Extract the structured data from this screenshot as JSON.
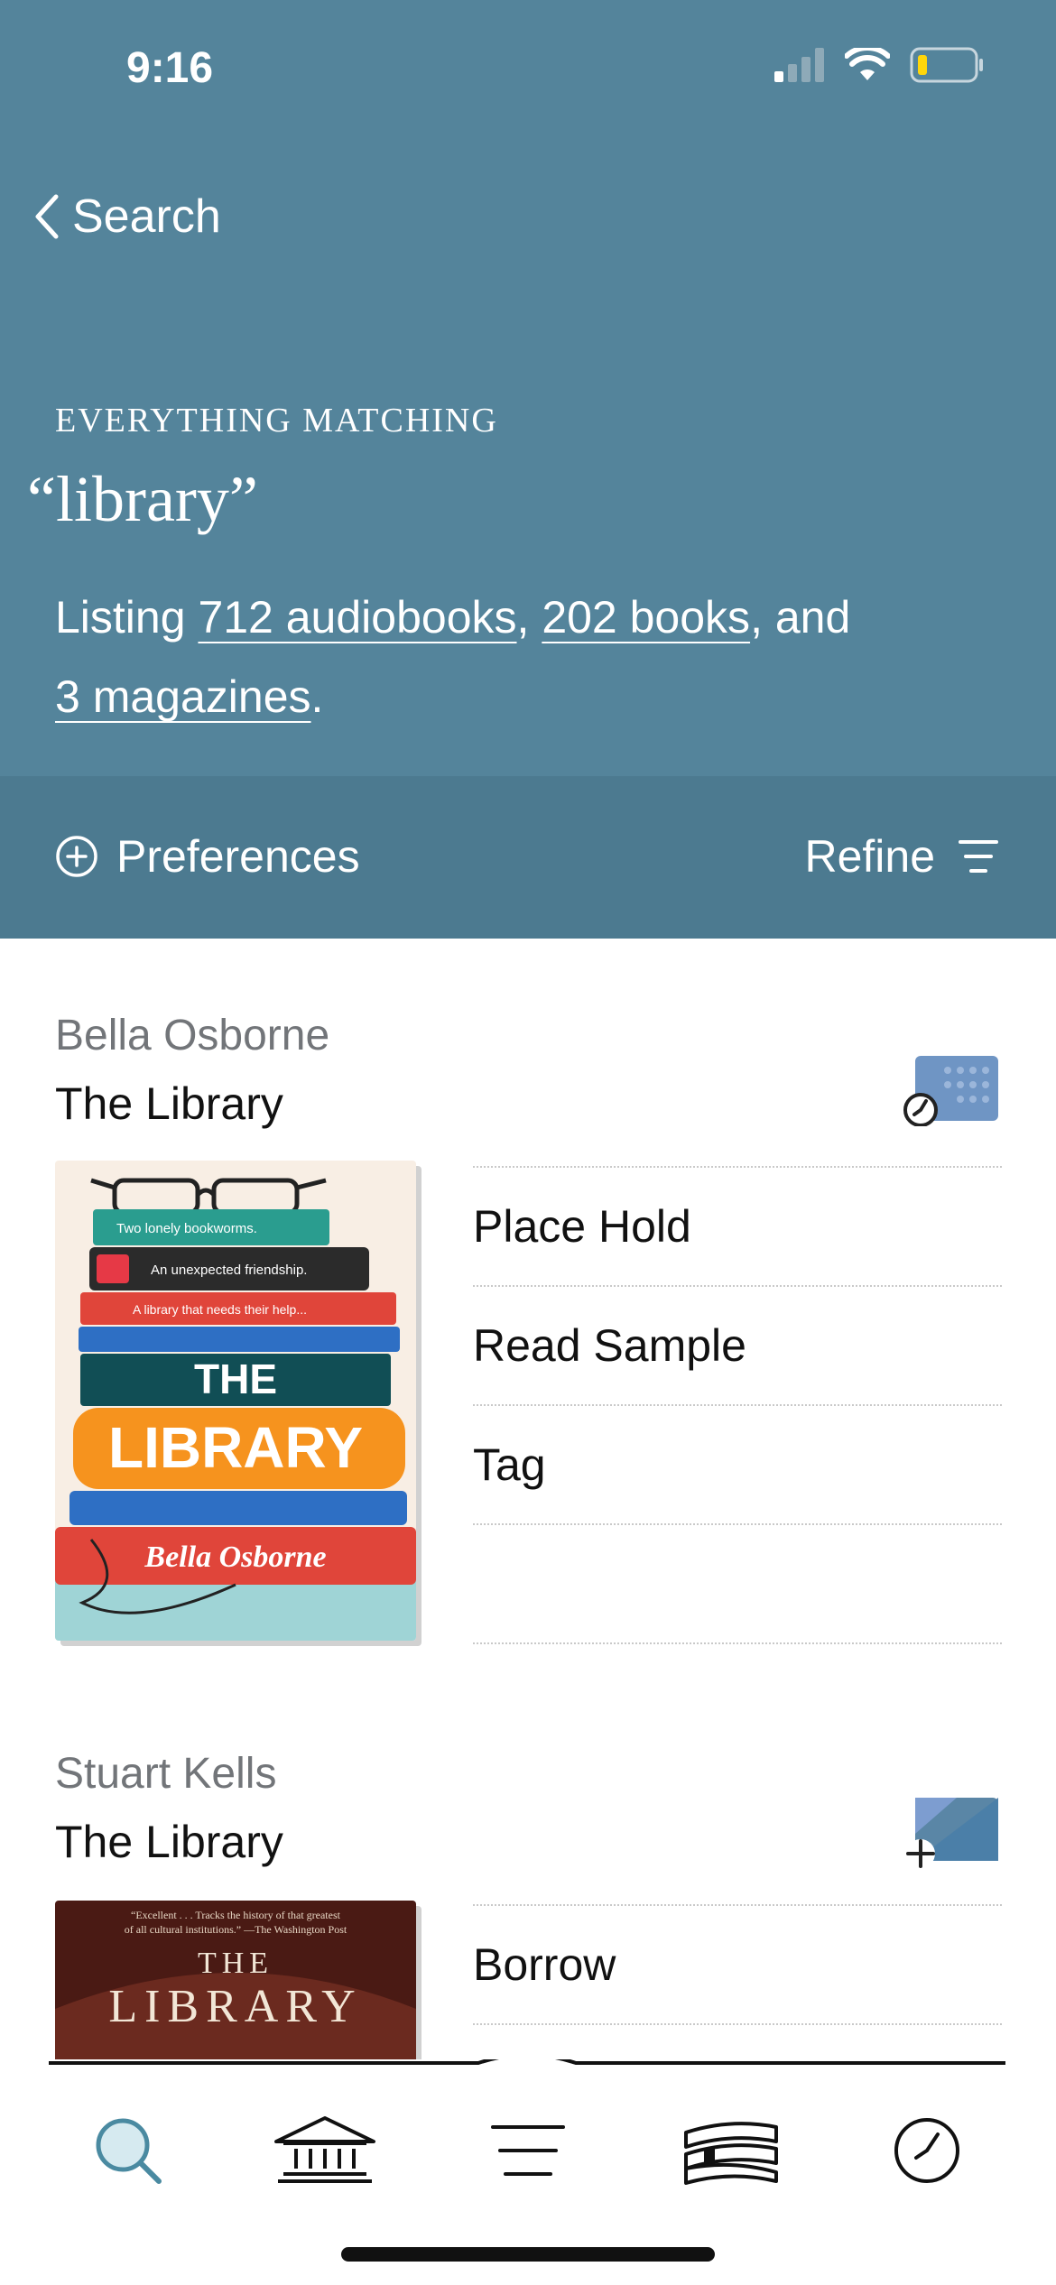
{
  "status": {
    "time": "9:16"
  },
  "nav": {
    "back_label": "Search"
  },
  "search": {
    "eyebrow": "EVERYTHING MATCHING",
    "query": "“library”",
    "listing_prefix": "Listing ",
    "audiobooks_link": "712 audiobooks",
    "sep1": ", ",
    "books_link": "202 books",
    "sep2": ", and ",
    "magazines_link": "3 magazines",
    "suffix": "."
  },
  "prefbar": {
    "preferences_label": "Preferences",
    "refine_label": "Refine"
  },
  "results": [
    {
      "author": "Bella Osborne",
      "title": "The Library",
      "format_icon": "audiobook-hold-icon",
      "cover_text": {
        "line1": "Two lonely bookworms.",
        "line2": "An unexpected friendship.",
        "line3": "A library that needs their help...",
        "title_a": "THE",
        "title_b": "LIBRARY",
        "author": "Bella Osborne"
      },
      "actions": [
        "Place Hold",
        "Read Sample",
        "Tag"
      ]
    },
    {
      "author": "Stuart Kells",
      "title": "The Library",
      "format_icon": "ebook-borrow-icon",
      "cover_text": {
        "quote1": "“Excellent . . . Tracks the history of that greatest",
        "quote2": "of all cultural institutions.” —The Washington Post",
        "title_a": "THE",
        "title_b": "LIBRARY"
      },
      "actions": [
        "Borrow"
      ]
    }
  ],
  "tabbar": {
    "tabs": [
      "search-icon",
      "library-icon",
      "menu-icon",
      "books-icon",
      "clock-icon"
    ]
  },
  "colors": {
    "header": "#54849b",
    "prefbar": "#4c7a90"
  }
}
